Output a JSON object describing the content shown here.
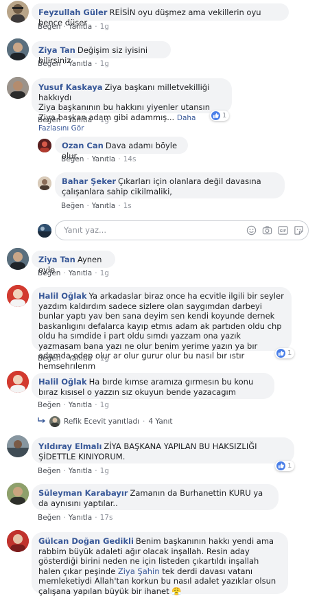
{
  "comments": [
    {
      "author": "Feyzullah Güler",
      "text": "REİSİN oyu düşmez ama vekillerin oyu bence düşer",
      "like": "Beğen",
      "reply": "Yanıtla",
      "time": "1g"
    },
    {
      "author": "Ziya Tan",
      "text": "Değişim siz iyisini bilirsiniz",
      "like": "Beğen",
      "reply": "Yanıtla",
      "time": "1g"
    },
    {
      "author": "Yusuf Kaskaya",
      "text_line1": "Ziya başkanı milletvekilliği hakkıydı",
      "text_line2": "Ziya başkanının bu hakkını yiyenler utansın",
      "text_line3": "Ziya başkan adam gibi adammış...",
      "see_more": "Daha Fazlasını Gör",
      "reactions": "1",
      "like": "Beğen",
      "reply": "Yanıtla",
      "time": "1g"
    },
    {
      "author": "Ozan Can",
      "text": "Dava adamı böyle olur.",
      "like": "Beğen",
      "reply": "Yanıtla",
      "time": "14s"
    },
    {
      "author": "Bahar Şeker",
      "text": "Çıkarları için olanlara değil davasına çalışanlara sahip cikilmaliki,",
      "like": "Beğen",
      "reply": "Yanıtla",
      "time": "1s"
    },
    {
      "author": "Ziya Tan",
      "text": "Aynen oyle",
      "like": "Beğen",
      "reply": "Yanıtla",
      "time": "1g"
    },
    {
      "author": "Halil Oğlak",
      "text": "Ya arkadaslar biraz once ha ecvitle ilgili bir seyler yazdım kaldırdım sadece sizlere olan saygımdan darbeyi bunlar yaptı yav ben sana deyim sen kendi koyunde dernek baskanlıgını defalarca kayıp etmıs adam ak partıden oldu chp oldu ha sımdide i part oldu sımdı yazzam ona yazık yazmasam bana yazı ne olur benim yerime yazın ya bır adamda edep olur ar olur gurur olur bu nasıl bır ıstır hemsehrılerım",
      "reactions": "1",
      "like": "Beğen",
      "reply": "Yanıtla",
      "time": "1g"
    },
    {
      "author": "Halil Oğlak",
      "text": "Ha bırde kımse aramıza gırmesın bu konu bıraz kısısel o yazzın sız okuyun bende yazacagım",
      "like": "Beğen",
      "reply": "Yanıtla",
      "time": "1g"
    },
    {
      "author": "Yıldıray Elmalı",
      "text": "ZİYA BAŞKANA YAPILAN BU HAKSIZLIĞI ŞİDETTLE KINIYORUM.",
      "reactions": "1",
      "like": "Beğen",
      "reply": "Yanıtla",
      "time": "1g"
    },
    {
      "author": "Süleyman Karabayır",
      "text": "Zamanın da Burhanettin KURU ya da aynısını yaptılar..",
      "like": "Beğen",
      "reply": "Yanıtla",
      "time": "17s"
    },
    {
      "author": "Gülcan Doğan Gedikli",
      "text_a": "Benim başkanının hakkı yendi ama rabbim büyük adaleti ağır olacak inşallah. Resin aday gösterdiği birini neden ne için listeden çıkartıldı inşallah halen çıkar peşinde ",
      "mention": "Ziya Şahin",
      "text_b": " tek derdi davası vatanı memleketiydi Allah'tan korkun bu nasıl adalet yazıklar olsun çalışana yapılan büyük bir ihanet 😤"
    }
  ],
  "reply_box": {
    "placeholder": "Yanıt yaz..."
  },
  "more_replies": {
    "author": "Refik Ecevit",
    "text": "Refik Ecevit yanıtladı",
    "sep": "·",
    "count": "4 Yanıt"
  },
  "dot": "·",
  "colors": {
    "link": "#385898",
    "bubble": "#f2f3f5",
    "like": "#4a7fe8"
  }
}
